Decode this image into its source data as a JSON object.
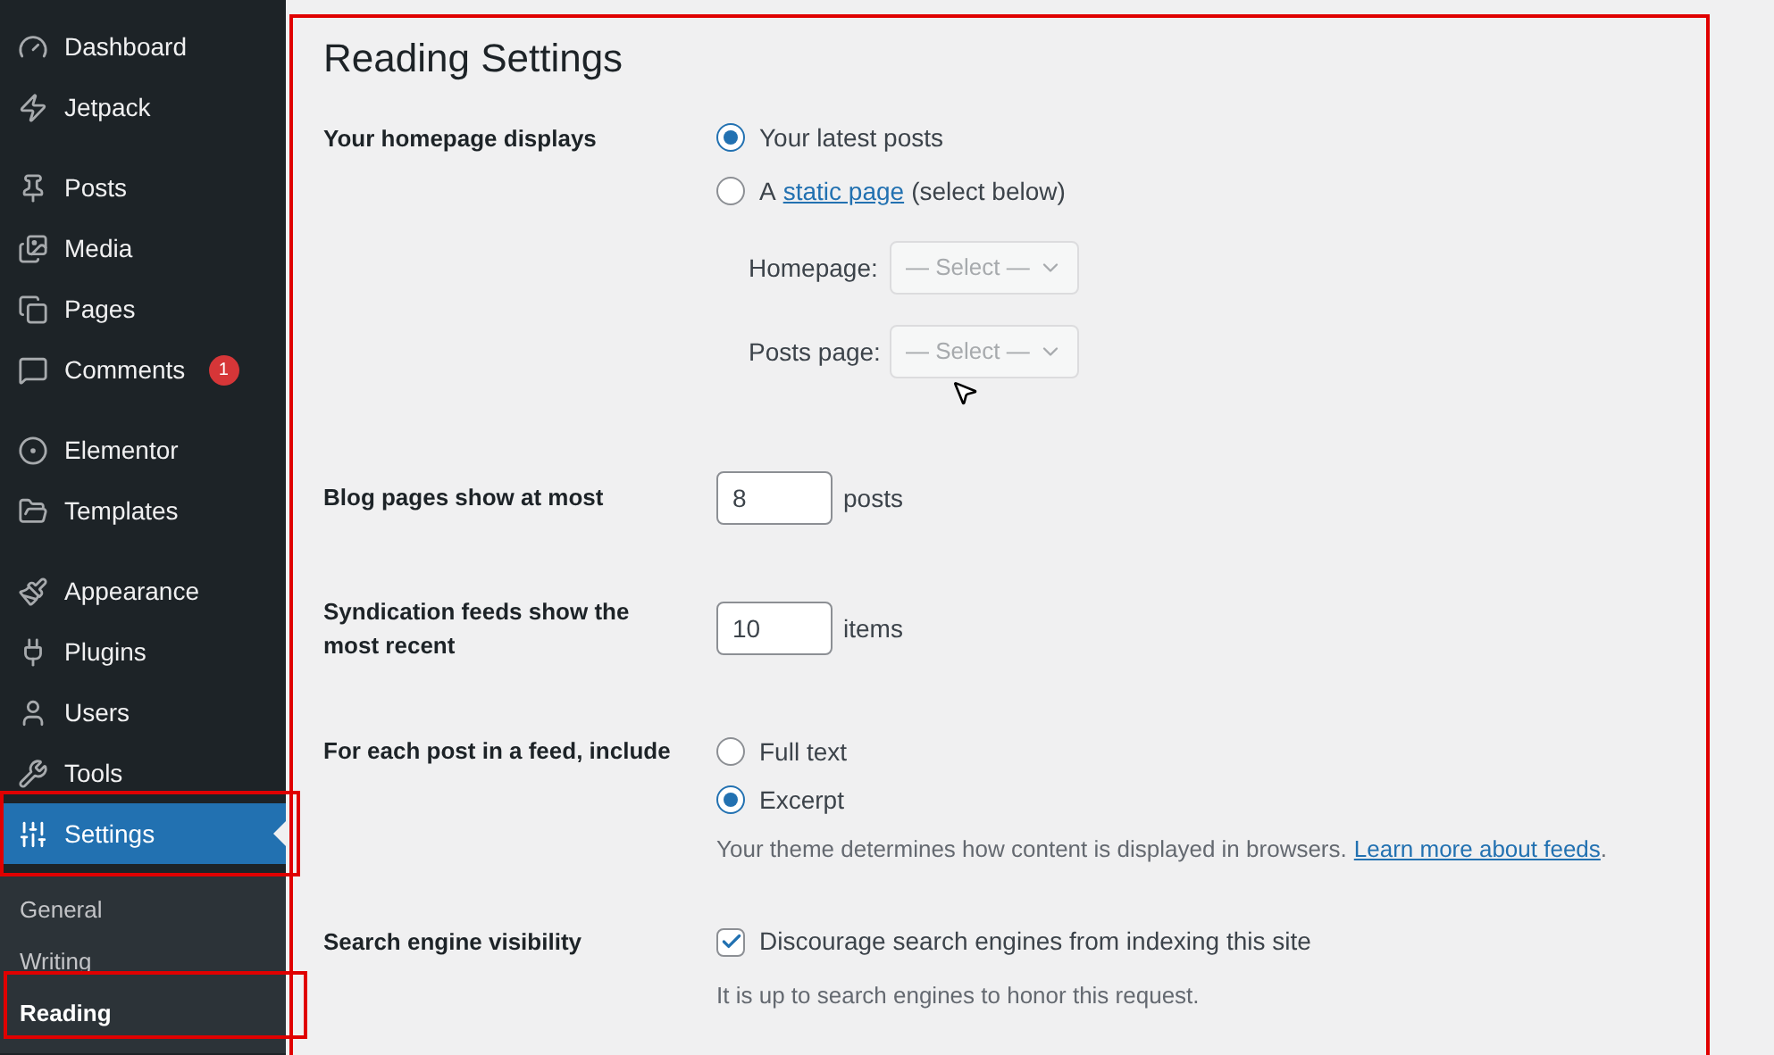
{
  "sidebar": {
    "groups": [
      [
        {
          "label": "Dashboard",
          "selected": false
        },
        {
          "label": "Jetpack",
          "selected": false
        }
      ],
      [
        {
          "label": "Posts",
          "selected": false
        },
        {
          "label": "Media",
          "selected": false
        },
        {
          "label": "Pages",
          "selected": false
        },
        {
          "label": "Comments",
          "selected": false,
          "badge": "1"
        }
      ],
      [
        {
          "label": "Elementor",
          "selected": false
        },
        {
          "label": "Templates",
          "selected": false
        }
      ],
      [
        {
          "label": "Appearance",
          "selected": false
        },
        {
          "label": "Plugins",
          "selected": false
        },
        {
          "label": "Users",
          "selected": false
        },
        {
          "label": "Tools",
          "selected": false
        },
        {
          "label": "Settings",
          "selected": true
        }
      ]
    ],
    "submenu": [
      {
        "label": "General",
        "selected": false
      },
      {
        "label": "Writing",
        "selected": false
      },
      {
        "label": "Reading",
        "selected": true
      }
    ]
  },
  "page": {
    "title": "Reading Settings",
    "homepage_displays": {
      "label": "Your homepage displays",
      "options": [
        {
          "label": "Your latest posts",
          "selected": true
        },
        {
          "label_prefix": "A",
          "link": "static page",
          "label_suffix": "(select below)",
          "selected": false
        }
      ],
      "selects": [
        {
          "label": "Homepage:",
          "value": "— Select —",
          "disabled": true
        },
        {
          "label": "Posts page:",
          "value": "— Select —",
          "disabled": true
        }
      ]
    },
    "blog_pages": {
      "label": "Blog pages show at most",
      "value": "8",
      "unit": "posts"
    },
    "syndication": {
      "label": "Syndication feeds show the most recent",
      "value": "10",
      "unit": "items"
    },
    "feed_include": {
      "label": "For each post in a feed, include",
      "options": [
        {
          "label": "Full text",
          "selected": false
        },
        {
          "label": "Excerpt",
          "selected": true
        }
      ],
      "description": "Your theme determines how content is displayed in browsers.",
      "link": "Learn more about feeds",
      "after_link": "."
    },
    "search_visibility": {
      "label": "Search engine visibility",
      "checkbox": {
        "label": "Discourage search engines from indexing this site",
        "checked": true
      },
      "note": "It is up to search engines to honor this request."
    }
  }
}
